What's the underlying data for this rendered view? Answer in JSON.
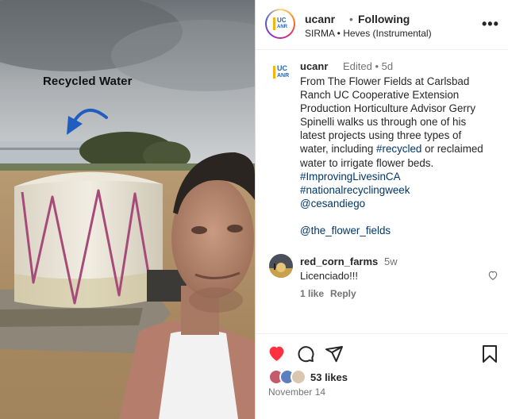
{
  "media": {
    "overlay_text": "Recycled Water"
  },
  "header": {
    "logo_text": "UC ANR",
    "logo_top": "UC",
    "logo_bottom": "ANR",
    "username": "ucanr",
    "separator": "•",
    "follow_status": "Following",
    "audio": "SIRMA • Heves (Instrumental)",
    "more_icon": "more-horizontal-icon"
  },
  "caption": {
    "username": "ucanr",
    "meta": "Edited • 5d",
    "lines": [
      [
        "From The Flower Fields at Carlsbad",
        null
      ],
      [
        "Ranch UC Cooperative Extension",
        null
      ],
      [
        "Production Horticulture Advisor Gerry",
        null
      ],
      [
        "Spinelli walks us through one of his",
        null
      ],
      [
        "latest projects using three types of",
        null
      ],
      [
        "water, including ",
        "#recycled",
        " or reclaimed"
      ],
      [
        "water to irrigate flower beds.",
        null
      ],
      [
        null,
        "#ImprovingLivesinCA"
      ],
      [
        null,
        "#nationalrecyclingweek"
      ],
      [
        null,
        "@cesandiego"
      ],
      [
        "",
        null
      ],
      [
        null,
        "@the_flower_fields"
      ]
    ]
  },
  "comment": {
    "username": "red_corn_farms",
    "time": "5w",
    "text": "Licenciado!!!",
    "likes": "1 like",
    "reply": "Reply"
  },
  "actions": {
    "like_icon": "heart-filled-icon",
    "comment_icon": "comment-icon",
    "share_icon": "share-icon",
    "save_icon": "bookmark-icon",
    "like_color": "#ff3040"
  },
  "likes_count": "53 likes",
  "post_date": "November 14"
}
